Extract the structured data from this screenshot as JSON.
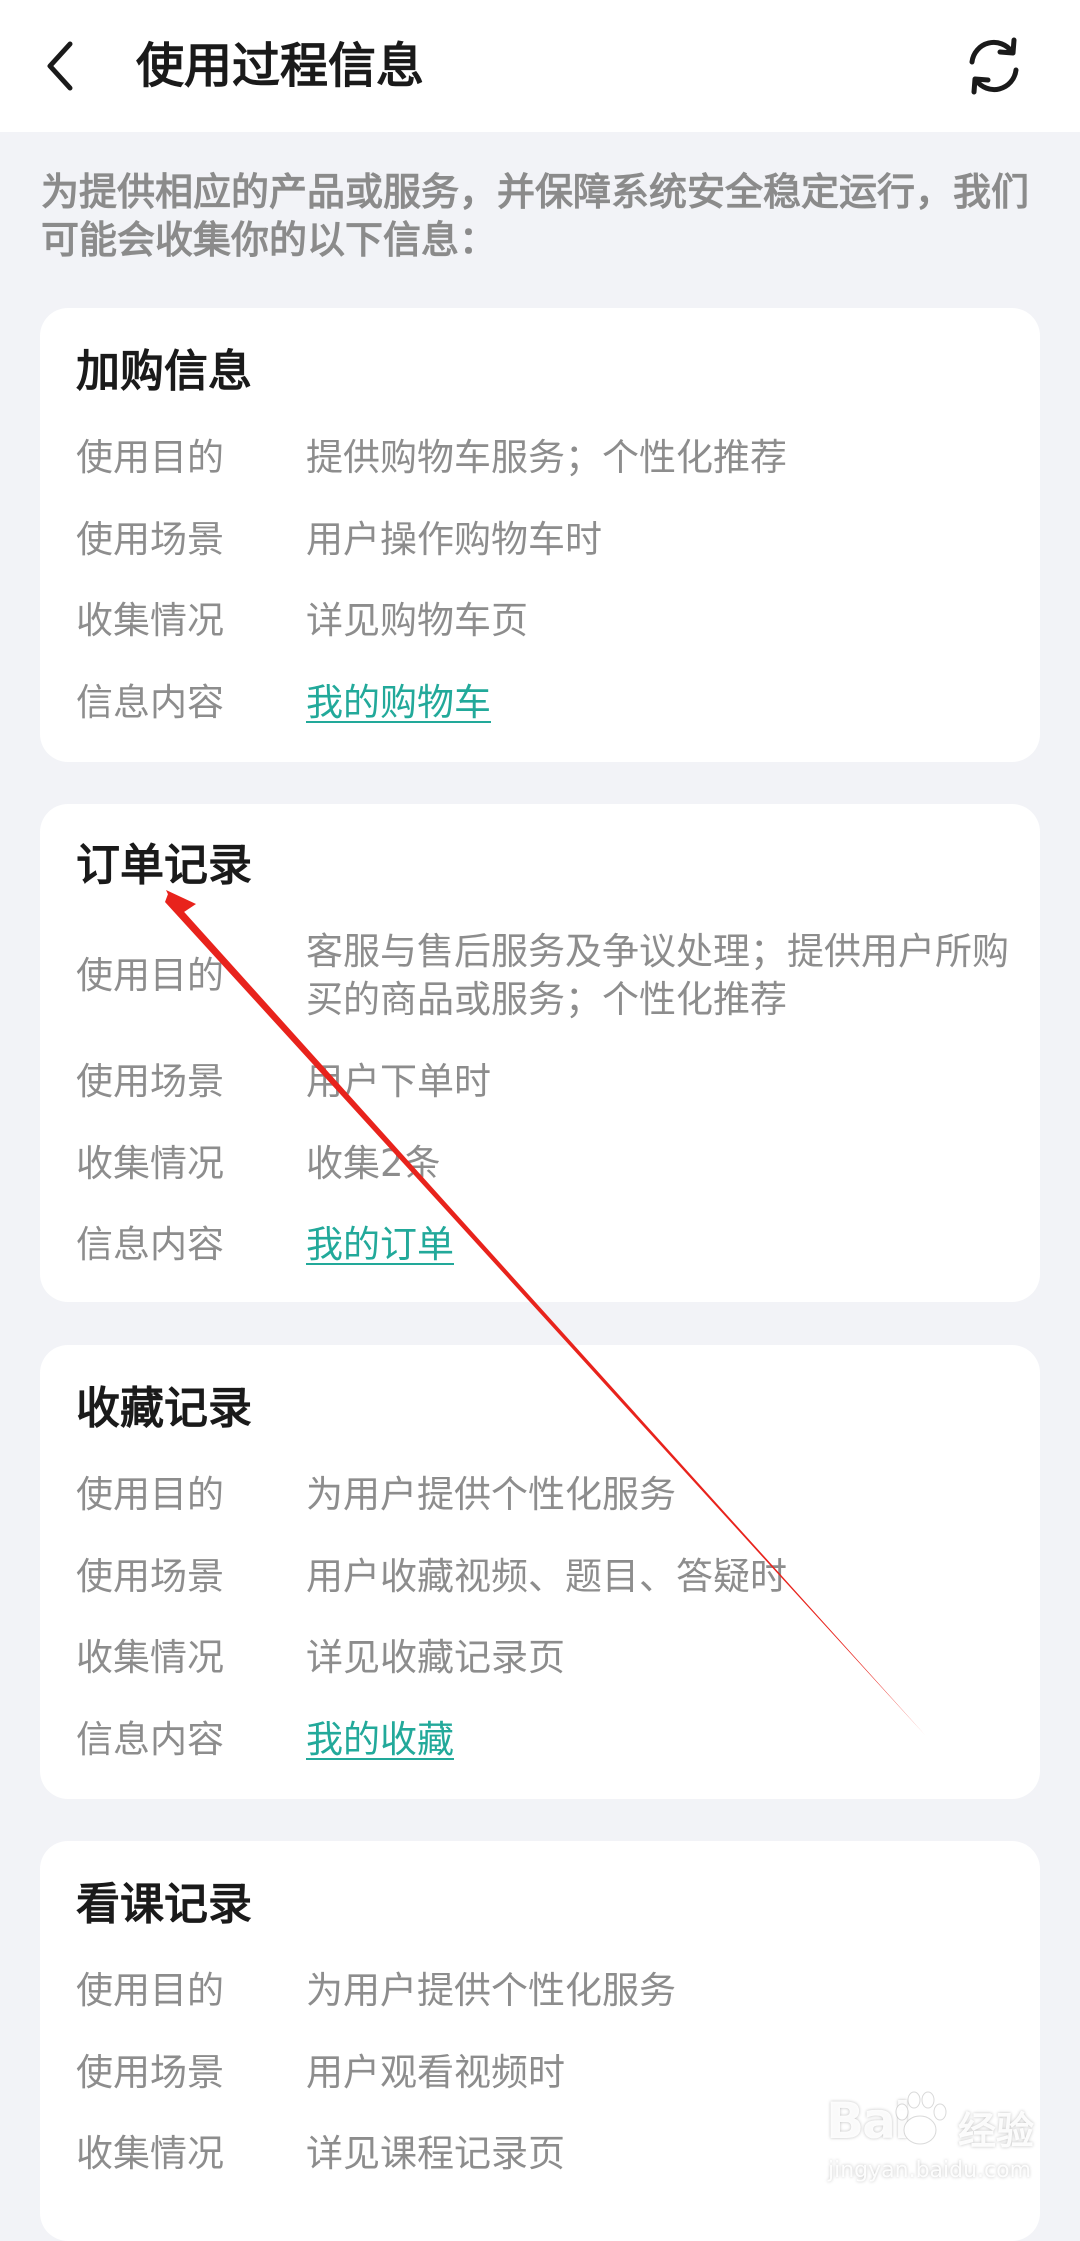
{
  "header": {
    "title": "使用过程信息",
    "back_icon": "chevron-left-icon",
    "refresh_icon": "refresh-icon"
  },
  "intro": "为提供相应的产品或服务，并保障系统安全稳定运行，我们可能会收集你的以下信息：",
  "colors": {
    "link": "#22a99a",
    "label": "#8d8d8d",
    "background": "#f2f3f7",
    "annotation_arrow": "#e8231c"
  },
  "cards": [
    {
      "title": "加购信息",
      "rows": [
        {
          "label": "使用目的",
          "value": "提供购物车服务；个性化推荐"
        },
        {
          "label": "使用场景",
          "value": "用户操作购物车时"
        },
        {
          "label": "收集情况",
          "value": "详见购物车页"
        },
        {
          "label": "信息内容",
          "value": "我的购物车"
        }
      ]
    },
    {
      "title": "订单记录",
      "rows": [
        {
          "label": "使用目的",
          "value": "客服与售后服务及争议处理；提供用户所购买的商品或服务；个性化推荐"
        },
        {
          "label": "使用场景",
          "value": "用户下单时"
        },
        {
          "label": "收集情况",
          "value": "收集2条"
        },
        {
          "label": "信息内容",
          "value": "我的订单"
        }
      ]
    },
    {
      "title": "收藏记录",
      "rows": [
        {
          "label": "使用目的",
          "value": "为用户提供个性化服务"
        },
        {
          "label": "使用场景",
          "value": "用户收藏视频、题目、答疑时"
        },
        {
          "label": "收集情况",
          "value": "详见收藏记录页"
        },
        {
          "label": "信息内容",
          "value": "我的收藏"
        }
      ]
    },
    {
      "title": "看课记录",
      "rows": [
        {
          "label": "使用目的",
          "value": "为用户提供个性化服务"
        },
        {
          "label": "使用场景",
          "value": "用户观看视频时"
        },
        {
          "label": "收集情况",
          "value": "详见课程记录页"
        }
      ]
    }
  ],
  "watermark": {
    "brand": "Bai",
    "brand_suffix": "经验",
    "url": "jingyan.baidu.com"
  }
}
